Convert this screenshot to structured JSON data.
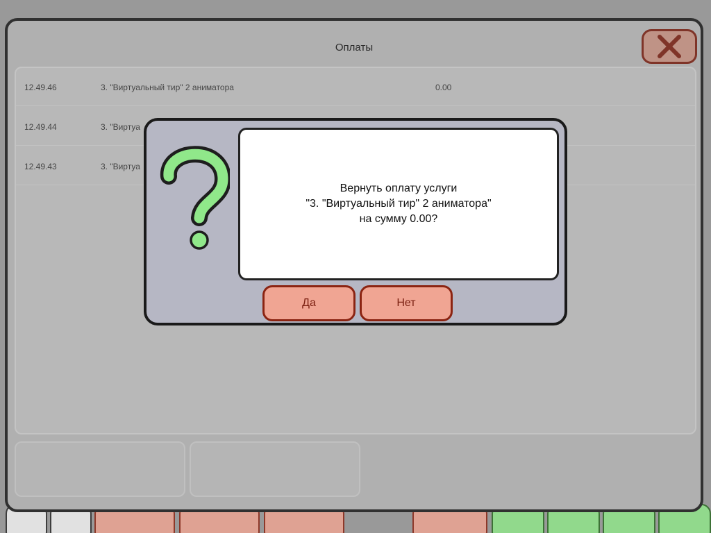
{
  "window": {
    "title": "Оплаты",
    "close_icon": "close-x-icon"
  },
  "payments": [
    {
      "time": "12.49.46",
      "service": "3. \"Виртуальный тир\" 2 аниматора",
      "amount": "0.00"
    },
    {
      "time": "12.49.44",
      "service": "3. \"Виртуа",
      "amount": ""
    },
    {
      "time": "12.49.43",
      "service": "3. \"Виртуа",
      "amount": ""
    }
  ],
  "dialog": {
    "icon": "question-mark-icon",
    "line1": "Вернуть оплату услуги",
    "line2": "\"3. \"Виртуальный тир\" 2 аниматора\"",
    "line3": "на сумму 0.00?",
    "yes_label": "Да",
    "no_label": "Нет"
  },
  "colors": {
    "accent_green": "#90e88a",
    "button_salmon": "#f0a593",
    "button_border": "#8b2412"
  }
}
